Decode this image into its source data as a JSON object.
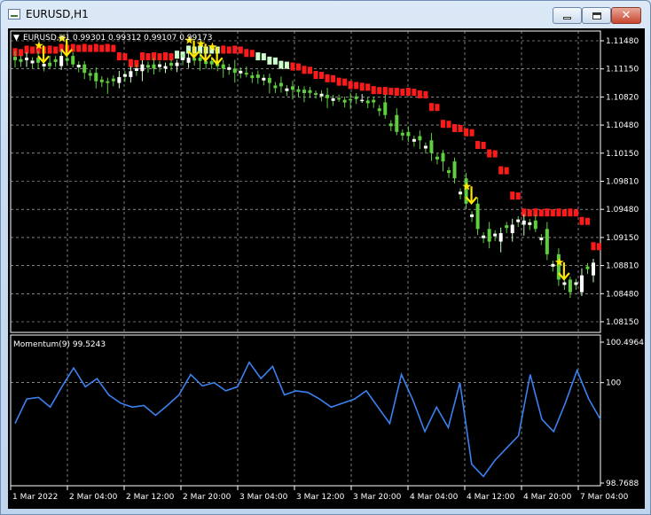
{
  "window": {
    "title": "EURUSD,H1"
  },
  "chart": {
    "header": "EURUSD,H1  0.99301 0.99312 0.99107 0.99173",
    "price_labels": [
      "1.11480",
      "1.11150",
      "1.10820",
      "1.10480",
      "1.10150",
      "1.09810",
      "1.09480",
      "1.09150",
      "1.08810",
      "1.08480",
      "1.08150"
    ],
    "time_labels": [
      "1 Mar 2022",
      "2 Mar 04:00",
      "2 Mar 12:00",
      "2 Mar 20:00",
      "3 Mar 04:00",
      "3 Mar 12:00",
      "3 Mar 20:00",
      "4 Mar 04:00",
      "4 Mar 12:00",
      "4 Mar 20:00",
      "7 Mar 04:00"
    ],
    "colors": {
      "bull": "#ffffff",
      "bear": "#5fcf3f",
      "bull_wick": "#c8ffc8",
      "band": "#ff1a1a",
      "band_dim": "#ccffcc",
      "signal": "#ffe600",
      "momentum": "#3b82f0",
      "grid": "#cfcfcf"
    }
  },
  "indicator": {
    "label": "Momentum(9) 99.5243",
    "labels": [
      "100.4964",
      "100",
      "98.7688"
    ]
  },
  "chart_data": {
    "type": "candlestick",
    "symbol": "EURUSD",
    "timeframe": "H1",
    "ohlc_last": {
      "open": 0.99301,
      "high": 0.99312,
      "low": 0.99107,
      "close": 0.99173
    },
    "price_range": [
      1.0815,
      1.1148
    ],
    "close_path": [
      1.1125,
      1.1128,
      1.1122,
      1.1118,
      1.113,
      1.112,
      1.111,
      1.11,
      1.1098,
      1.1105,
      1.1112,
      1.112,
      1.1115,
      1.1118,
      1.1122,
      1.1128,
      1.1124,
      1.112,
      1.1115,
      1.111,
      1.1108,
      1.1104,
      1.1098,
      1.1094,
      1.109,
      1.1086,
      1.1084,
      1.108,
      1.1079,
      1.1078,
      1.1078,
      1.1075,
      1.106,
      1.104,
      1.1035,
      1.103,
      1.1015,
      1.1005,
      1.0985,
      1.0955,
      1.0925,
      1.091,
      1.092,
      1.093,
      1.0935,
      1.0925,
      1.0895,
      1.0865,
      1.085,
      1.087,
      1.0885
    ],
    "momentum": {
      "name": "Momentum(9)",
      "ylim": [
        98.7688,
        100.4964
      ],
      "values": [
        99.5,
        99.8,
        99.82,
        99.7,
        99.95,
        100.18,
        99.95,
        100.05,
        99.85,
        99.75,
        99.7,
        99.72,
        99.6,
        99.72,
        99.85,
        100.1,
        99.96,
        100.0,
        99.9,
        99.95,
        100.25,
        100.05,
        100.2,
        99.85,
        99.9,
        99.88,
        99.8,
        99.7,
        99.75,
        99.8,
        99.9,
        99.7,
        99.5,
        100.1,
        99.78,
        99.4,
        99.7,
        99.45,
        100.0,
        99.0,
        98.85,
        99.05,
        99.2,
        99.35,
        100.1,
        99.55,
        99.4,
        99.75,
        100.15,
        99.8,
        99.55
      ]
    }
  }
}
